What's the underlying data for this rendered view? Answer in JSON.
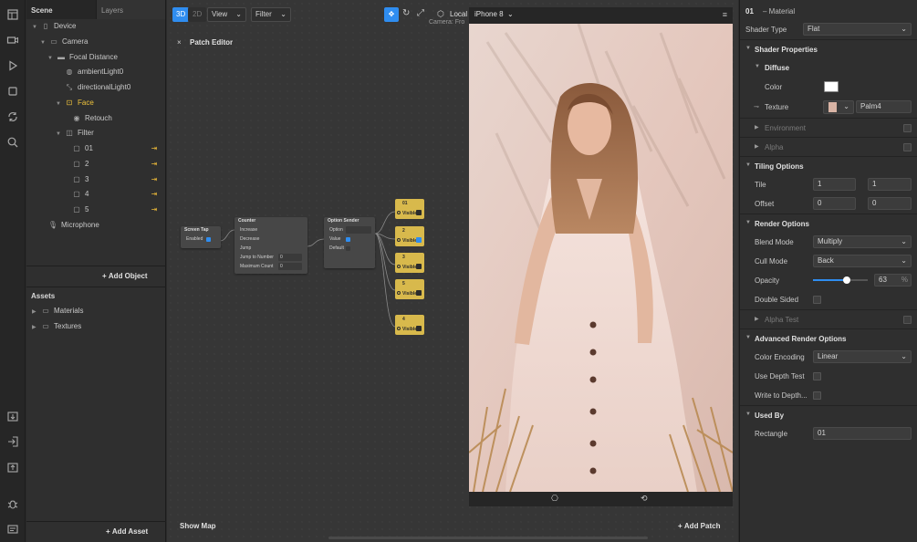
{
  "scene": {
    "tab_scene": "Scene",
    "tab_layers": "Layers",
    "tree": {
      "device": "Device",
      "camera": "Camera",
      "focal_distance": "Focal Distance",
      "ambient_light": "ambientLight0",
      "directional_light": "directionalLight0",
      "face": "Face",
      "retouch": "Retouch",
      "filter": "Filter",
      "item_01": "01",
      "item_2": "2",
      "item_3": "3",
      "item_4": "4",
      "item_5": "5",
      "microphone": "Microphone"
    },
    "add_object": "Add Object",
    "assets_title": "Assets",
    "materials": "Materials",
    "textures": "Textures",
    "add_asset": "Add Asset"
  },
  "toolbar": {
    "btn_3d": "3D",
    "btn_2d": "2D",
    "view": "View",
    "filter": "Filter",
    "camera_label": "Local",
    "camera_sub": "Camera: Fro",
    "device": "iPhone 8"
  },
  "patch_editor": {
    "title": "Patch Editor",
    "show_map": "Show Map",
    "add_patch": "Add Patch",
    "nodes": {
      "screen_tap": {
        "title": "Screen Tap",
        "enabled": "Enabled"
      },
      "counter": {
        "title": "Counter",
        "increase": "Increase",
        "decrease": "Decrease",
        "jump": "Jump",
        "jump_to_number": "Jump to Number",
        "jump_to_number_value": "0",
        "maximum_count": "Maximum Count",
        "maximum_count_value": "0"
      },
      "option_sender": {
        "title": "Option Sender",
        "option": "Option",
        "value": "Value",
        "default": "Default"
      },
      "outputs": [
        {
          "title": "01",
          "label": "Visible",
          "on": false
        },
        {
          "title": "2",
          "label": "Visible",
          "on": true
        },
        {
          "title": "3",
          "label": "Visible",
          "on": false
        },
        {
          "title": "5",
          "label": "Visible",
          "on": false
        },
        {
          "title": "4",
          "label": "Visible",
          "on": false
        }
      ]
    }
  },
  "inspector": {
    "object_id": "01",
    "object_type": "– Material",
    "shader_type_label": "Shader Type",
    "shader_type_value": "Flat",
    "shader_properties": "Shader Properties",
    "diffuse": "Diffuse",
    "color_label": "Color",
    "texture_label": "Texture",
    "texture_value": "Palm4",
    "environment": "Environment",
    "alpha": "Alpha",
    "tiling_options": "Tiling Options",
    "tile_label": "Tile",
    "tile_x": "1",
    "tile_y": "1",
    "offset_label": "Offset",
    "offset_x": "0",
    "offset_y": "0",
    "render_options": "Render Options",
    "blend_mode_label": "Blend Mode",
    "blend_mode_value": "Multiply",
    "cull_mode_label": "Cull Mode",
    "cull_mode_value": "Back",
    "opacity_label": "Opacity",
    "opacity_value": "63",
    "opacity_unit": "%",
    "double_sided": "Double Sided",
    "alpha_test": "Alpha Test",
    "advanced_render_options": "Advanced Render Options",
    "color_encoding_label": "Color Encoding",
    "color_encoding_value": "Linear",
    "use_depth_test": "Use Depth Test",
    "write_to_depth": "Write to Depth...",
    "used_by": "Used By",
    "rectangle_label": "Rectangle",
    "rectangle_value": "01"
  },
  "colors": {
    "accent": "#2f8df0",
    "face_highlight": "#f0c33c",
    "patch_yellow": "#d8b94c"
  }
}
